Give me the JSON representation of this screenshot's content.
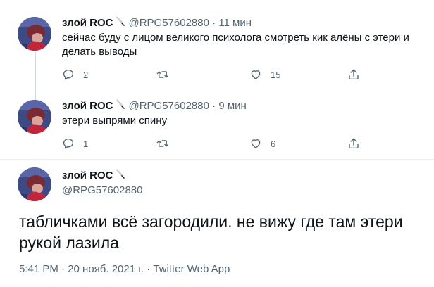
{
  "thread": [
    {
      "author_name": "злой ROC",
      "handle": "@RPG57602880",
      "separator": "·",
      "time": "11 мин",
      "text_line1": "сейчас буду с лицом великого психолога смотреть кик алёны с этери и",
      "text_line2": "делать выводы",
      "replies": "2",
      "retweets": "",
      "likes": "15"
    },
    {
      "author_name": "злой ROC",
      "handle": "@RPG57602880",
      "separator": "·",
      "time": "9 мин",
      "text_line1": "этери выпрями спину",
      "replies": "1",
      "retweets": "",
      "likes": "6"
    }
  ],
  "main_tweet": {
    "author_name": "злой ROC",
    "handle": "@RPG57602880",
    "text_line1": "табличками всё загородили. не вижу где там этери",
    "text_line2": "рукой лазила",
    "meta": "5:41 PM · 20 нояб. 2021 г. · Twitter Web App"
  },
  "icons": {
    "reply": "reply-icon",
    "retweet": "retweet-icon",
    "like": "heart-icon",
    "share": "share-icon",
    "name_emoji": "knife-icon"
  },
  "colors": {
    "text": "#0f1419",
    "secondary": "#536471",
    "thread_line": "#cfd9de",
    "divider": "#eff3f4"
  }
}
